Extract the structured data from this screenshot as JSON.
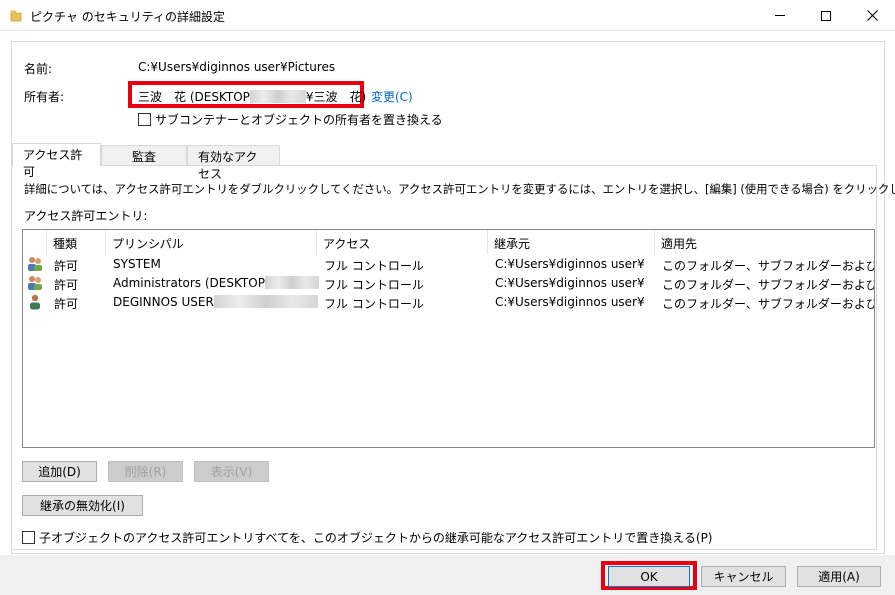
{
  "window": {
    "title": "ピクチャ のセキュリティの詳細設定"
  },
  "name_row": {
    "label": "名前:",
    "value": "C:¥Users¥diginnos user¥Pictures"
  },
  "owner_row": {
    "label": "所有者:",
    "value_prefix": "三波　花 (DESKTOP",
    "value_suffix": "¥三波　花)",
    "change_link": "変更(C)"
  },
  "replace_owner_checkbox": {
    "label": "サブコンテナーとオブジェクトの所有者を置き換える",
    "checked": false
  },
  "tabs": [
    {
      "label": "アクセス許可",
      "active": true
    },
    {
      "label": "監査",
      "active": false
    },
    {
      "label": "有効なアクセス",
      "active": false
    }
  ],
  "info_text": "詳細については、アクセス許可エントリをダブルクリックしてください。アクセス許可エントリを変更するには、エントリを選択し、[編集] (使用できる場合) をクリックします。",
  "entries_label": "アクセス許可エントリ:",
  "permission_table": {
    "columns": [
      "種類",
      "プリンシパル",
      "アクセス",
      "継承元",
      "適用先"
    ],
    "rows": [
      {
        "icon": "group-users-icon",
        "type": "許可",
        "principal": "SYSTEM",
        "access": "フル コントロール",
        "inherited_from": "C:¥Users¥diginnos user¥",
        "applies_to": "このフォルダー、サブフォルダーおよびファイル"
      },
      {
        "icon": "group-users-icon",
        "type": "許可",
        "principal": "Administrators (DESKTOP",
        "access": "フル コントロール",
        "inherited_from": "C:¥Users¥diginnos user¥",
        "applies_to": "このフォルダー、サブフォルダーおよびファイル"
      },
      {
        "icon": "single-user-icon",
        "type": "許可",
        "principal": "DEGINNOS USER",
        "access": "フル コントロール",
        "inherited_from": "C:¥Users¥diginnos user¥",
        "applies_to": "このフォルダー、サブフォルダーおよびファイル"
      }
    ]
  },
  "buttons": {
    "add": "追加(D)",
    "remove": "削除(R)",
    "view": "表示(V)",
    "disable_inheritance": "継承の無効化(I)"
  },
  "replace_child_checkbox": {
    "label": "子オブジェクトのアクセス許可エントリすべてを、このオブジェクトからの継承可能なアクセス許可エントリで置き換える(P)",
    "checked": false
  },
  "footer": {
    "ok": "OK",
    "cancel": "キャンセル",
    "apply": "適用(A)"
  },
  "colors": {
    "highlight_red": "#e60012",
    "link_blue": "#0066cc",
    "footer_bg": "#f0f0f0"
  }
}
